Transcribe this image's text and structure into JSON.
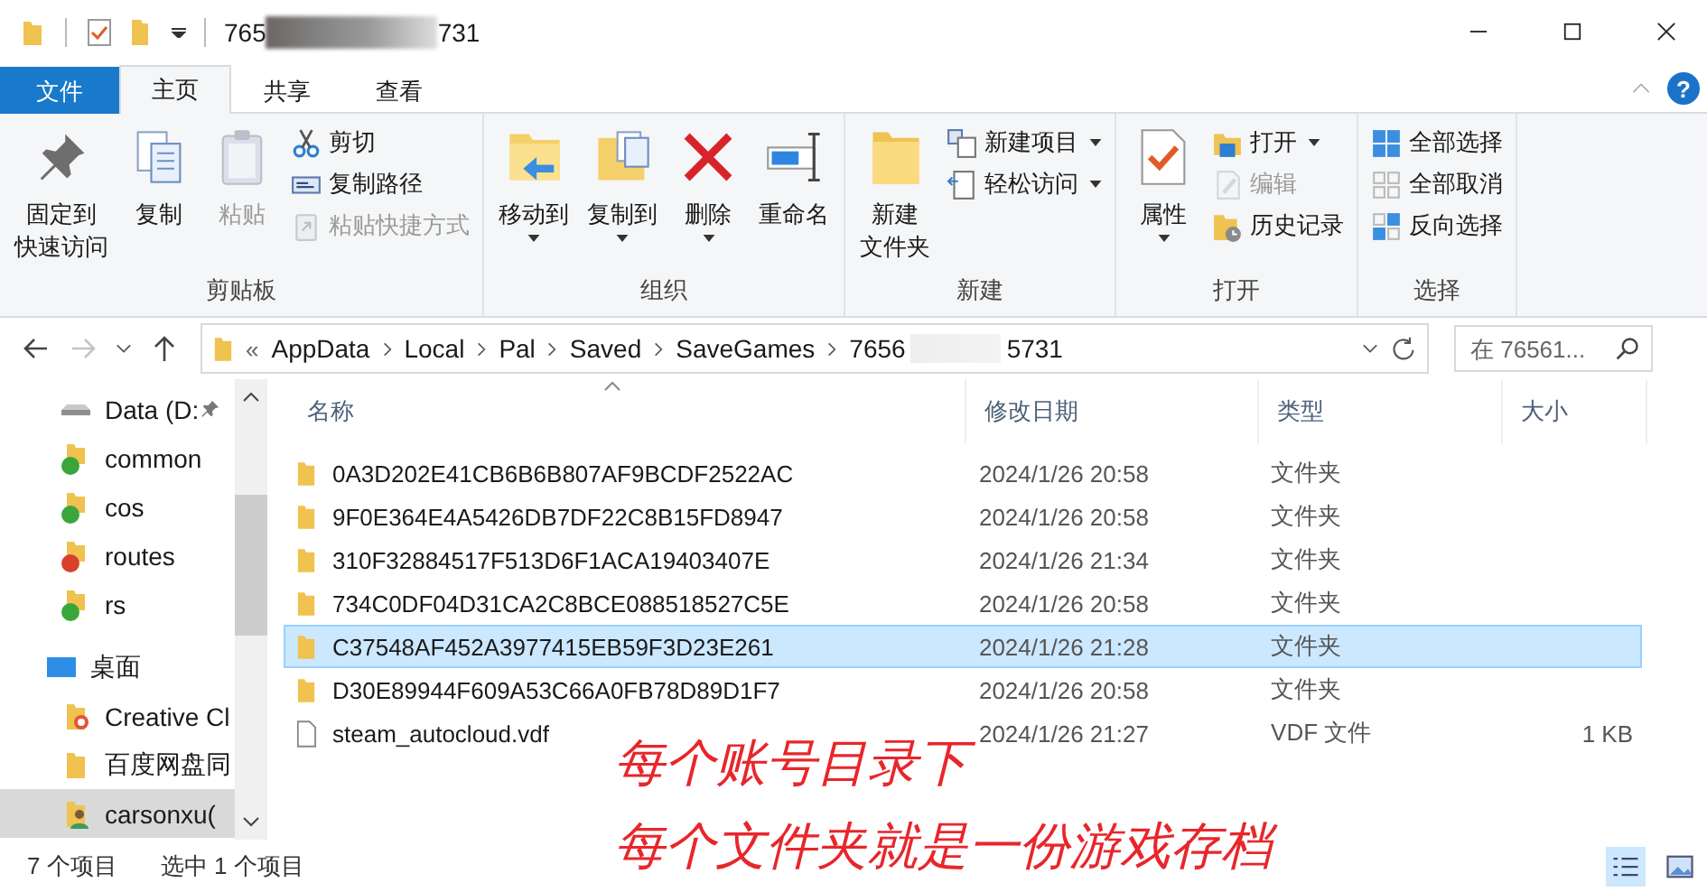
{
  "title_bar": {
    "title_start": "765",
    "title_end": "731"
  },
  "ribbon": {
    "tabs": [
      {
        "label": "文件",
        "kind": "file",
        "selected": false
      },
      {
        "label": "主页",
        "kind": "tab",
        "selected": true
      },
      {
        "label": "共享",
        "kind": "tab",
        "selected": false
      },
      {
        "label": "查看",
        "kind": "tab",
        "selected": false
      }
    ],
    "help": "?",
    "groups": [
      {
        "label": "剪贴板",
        "large": [
          {
            "lines": [
              "固定到",
              "快速访问"
            ],
            "disabled": false,
            "dropdown": false
          },
          {
            "lines": [
              "复制"
            ],
            "disabled": false,
            "dropdown": false
          },
          {
            "lines": [
              "粘贴"
            ],
            "disabled": true,
            "dropdown": false
          }
        ],
        "small": [
          {
            "label": "剪切",
            "disabled": false,
            "dropdown": false
          },
          {
            "label": "复制路径",
            "disabled": false,
            "dropdown": false
          },
          {
            "label": "粘贴快捷方式",
            "disabled": true,
            "dropdown": false
          }
        ]
      },
      {
        "label": "组织",
        "large": [
          {
            "lines": [
              "移动到"
            ],
            "disabled": false,
            "dropdown": true
          },
          {
            "lines": [
              "复制到"
            ],
            "disabled": false,
            "dropdown": true
          },
          {
            "lines": [
              "删除"
            ],
            "disabled": false,
            "dropdown": true
          },
          {
            "lines": [
              "重命名"
            ],
            "disabled": false,
            "dropdown": false
          }
        ]
      },
      {
        "label": "新建",
        "large": [
          {
            "lines": [
              "新建",
              "文件夹"
            ],
            "disabled": false,
            "dropdown": false
          }
        ],
        "small": [
          {
            "label": "新建项目",
            "disabled": false,
            "dropdown": true
          },
          {
            "label": "轻松访问",
            "disabled": false,
            "dropdown": true
          }
        ]
      },
      {
        "label": "打开",
        "large": [
          {
            "lines": [
              "属性"
            ],
            "disabled": false,
            "dropdown": true
          }
        ],
        "small": [
          {
            "label": "打开",
            "disabled": false,
            "dropdown": true
          },
          {
            "label": "编辑",
            "disabled": true,
            "dropdown": false
          },
          {
            "label": "历史记录",
            "disabled": false,
            "dropdown": false
          }
        ]
      },
      {
        "label": "选择",
        "small": [
          {
            "label": "全部选择",
            "disabled": false,
            "dropdown": false
          },
          {
            "label": "全部取消",
            "disabled": false,
            "dropdown": false
          },
          {
            "label": "反向选择",
            "disabled": false,
            "dropdown": false
          }
        ]
      }
    ]
  },
  "navigation": {
    "back": {
      "disabled": false
    },
    "forward": {
      "disabled": true
    }
  },
  "address_bar": {
    "overflow_mark": "«",
    "crumbs": [
      "AppData",
      "Local",
      "Pal",
      "Saved",
      "SaveGames"
    ],
    "last_crumb_start": "7656",
    "last_crumb_end": "5731"
  },
  "search": {
    "placeholder": "在 76561..."
  },
  "sidebar": {
    "items": [
      {
        "label": "Data (D:",
        "kind": "drive",
        "pinned": true,
        "selected": false
      },
      {
        "label": "common",
        "kind": "synced-folder",
        "color": "#3aa63a",
        "pinned": false,
        "selected": false
      },
      {
        "label": "cos",
        "kind": "synced-folder",
        "color": "#3aa63a",
        "pinned": false,
        "selected": false
      },
      {
        "label": "routes",
        "kind": "synced-folder",
        "color": "#d9402b",
        "pinned": false,
        "selected": false
      },
      {
        "label": "rs",
        "kind": "synced-folder",
        "color": "#3aa63a",
        "pinned": false,
        "selected": false
      },
      {
        "label": "桌面",
        "kind": "desktop",
        "pinned": false,
        "selected": false
      },
      {
        "label": "Creative Cl",
        "kind": "app-folder",
        "pinned": false,
        "selected": false
      },
      {
        "label": "百度网盘同",
        "kind": "folder",
        "pinned": false,
        "selected": false
      },
      {
        "label": "carsonxu(",
        "kind": "user-folder",
        "pinned": false,
        "selected": true
      }
    ]
  },
  "file_list": {
    "columns": [
      "名称",
      "修改日期",
      "类型",
      "大小"
    ],
    "rows": [
      {
        "name": "0A3D202E41CB6B6B807AF9BCDF2522AC",
        "date": "2024/1/26 20:58",
        "type": "文件夹",
        "kind": "folder",
        "selected": false
      },
      {
        "name": "9F0E364E4A5426DB7DF22C8B15FD8947",
        "date": "2024/1/26 20:58",
        "type": "文件夹",
        "kind": "folder",
        "selected": false
      },
      {
        "name": "310F32884517F513D6F1ACA19403407E",
        "date": "2024/1/26 21:34",
        "type": "文件夹",
        "kind": "folder",
        "selected": false
      },
      {
        "name": "734C0DF04D31CA2C8BCE088518527C5E",
        "date": "2024/1/26 20:58",
        "type": "文件夹",
        "kind": "folder",
        "selected": false
      },
      {
        "name": "C37548AF452A3977415EB59F3D23E261",
        "date": "2024/1/26 21:28",
        "type": "文件夹",
        "kind": "folder",
        "selected": true
      },
      {
        "name": "D30E89944F609A53C66A0FB78D89D1F7",
        "date": "2024/1/26 20:58",
        "type": "文件夹",
        "kind": "folder",
        "selected": false
      },
      {
        "name": "steam_autocloud.vdf",
        "date": "2024/1/26 21:27",
        "type": "VDF 文件",
        "size": "1 KB",
        "kind": "file",
        "selected": false
      }
    ]
  },
  "status_bar": {
    "item_count": "7 个项目",
    "selection": "选中 1 个项目"
  },
  "annotation": [
    "每个账号目录下",
    "每个文件夹就是一份游戏存档"
  ]
}
